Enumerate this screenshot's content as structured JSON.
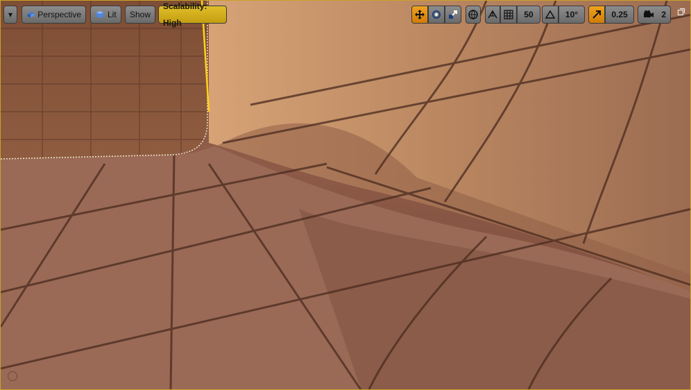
{
  "toolbar": {
    "dropdown_label": "▾",
    "perspective_label": "Perspective",
    "lit_label": "Lit",
    "show_label": "Show",
    "scalability_label": "Scalability: High",
    "grid_snap_value": "50",
    "rotation_snap_value": "10°",
    "scale_snap_value": "0.25",
    "camera_speed_value": "2"
  },
  "colors": {
    "accent": "#c9a227",
    "active_orange": "#e08a12",
    "highlight_yellow": "#d4b01f"
  },
  "icons": {
    "perspective": "perspective-cube-icon",
    "lit": "lit-sphere-icon",
    "translate": "translate-arrows-icon",
    "rotate": "rotate-icon",
    "scale": "scale-icon",
    "world": "world-globe-icon",
    "surface_snap": "surface-snap-icon",
    "grid": "grid-icon",
    "angle": "angle-icon",
    "scale_snap": "scale-snap-arrow-icon",
    "camera": "camera-icon",
    "maximize": "maximize-icon"
  }
}
